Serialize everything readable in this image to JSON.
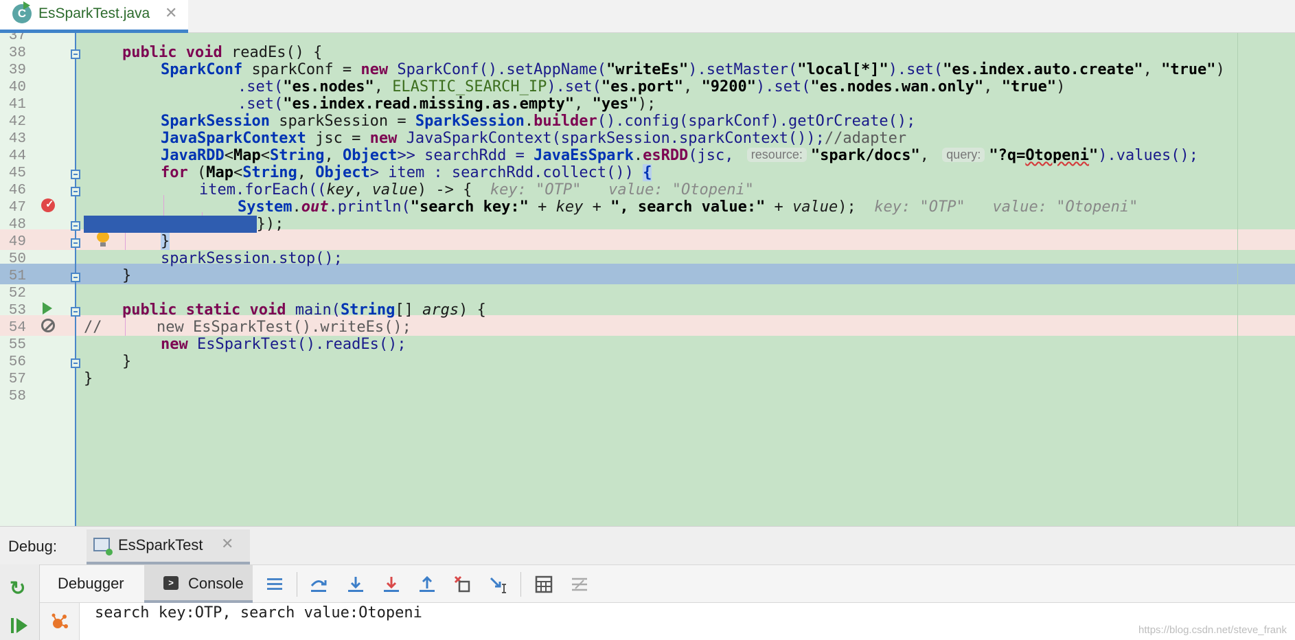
{
  "tab": {
    "icon_letter": "C",
    "title": "EsSparkTest.java",
    "close_glyph": "✕"
  },
  "editor": {
    "line_numbers": [
      "37",
      "38",
      "39",
      "40",
      "41",
      "42",
      "43",
      "44",
      "45",
      "46",
      "47",
      "48",
      "49",
      "50",
      "51",
      "52",
      "53",
      "54",
      "55",
      "56",
      "57",
      "58"
    ],
    "code": {
      "l38": [
        "public",
        "void",
        "readEs() {"
      ],
      "l39": [
        "SparkConf",
        " sparkConf = ",
        "new",
        "SparkConf",
        "().setAppName(",
        "\"writeEs\"",
        ").setMaster(",
        "\"local[*]\"",
        ").set(",
        "\"es.index.auto.create\"",
        ", ",
        "\"true\"",
        ")"
      ],
      "l40": [
        ".set(",
        "\"es.nodes\"",
        ", ",
        "ELASTIC_SEARCH_IP",
        ").set(",
        "\"es.port\"",
        ", ",
        "\"9200\"",
        ").set(",
        "\"es.nodes.wan.only\"",
        ", ",
        "\"true\"",
        ")"
      ],
      "l41": [
        ".set(",
        "\"es.index.read.missing.as.empty\"",
        ", ",
        "\"yes\"",
        ");"
      ],
      "l42": [
        "SparkSession",
        " sparkSession = ",
        "SparkSession",
        ".",
        "builder",
        "().config(sparkConf).getOrCreate();"
      ],
      "l43": [
        "JavaSparkContext",
        " jsc = ",
        "new",
        "JavaSparkContext",
        "(sparkSession.sparkContext());",
        "//adapter"
      ],
      "l44": [
        "JavaRDD",
        "<",
        "Map",
        "<",
        "String",
        ", ",
        "Object",
        ">> searchRdd = ",
        "JavaEsSpark",
        ".",
        "esRDD",
        "(jsc, ",
        "resource:",
        "\"spark/docs\"",
        ", ",
        "query:",
        "\"?q=",
        "Otopeni",
        "\"",
        ").values();"
      ],
      "l45": [
        "for",
        " (",
        "Map",
        "<",
        "String",
        ", ",
        "Object",
        "> item : searchRdd.collect()) ",
        "{"
      ],
      "l46": [
        "item.forEach((",
        "key",
        ", ",
        "value",
        ") -> {",
        "key: \"OTP\"   value: \"Otopeni\""
      ],
      "l47": [
        "System",
        ".",
        "out",
        ".println(",
        "\"search key:\"",
        " + ",
        "key",
        " + ",
        "\", search value:\"",
        " + ",
        "value",
        ");",
        "key: \"OTP\"   value: \"Otopeni\""
      ],
      "l48": [
        "});"
      ],
      "l49": [
        "}"
      ],
      "l50": [
        "sparkSession.stop();"
      ],
      "l51": [
        "}"
      ],
      "l53": [
        "public",
        "static",
        "void",
        "main(",
        "String",
        "[] ",
        "args",
        ") {"
      ],
      "l54": [
        "//",
        "new EsSparkTest().writeEs();"
      ],
      "l55": [
        "new",
        " EsSparkTest().readEs();"
      ],
      "l56": [
        "}"
      ],
      "l57": [
        "}"
      ]
    }
  },
  "debug": {
    "label": "Debug:",
    "run_tab": "EsSparkTest",
    "close_glyph": "✕",
    "tabs": [
      "Debugger",
      "Console"
    ],
    "toolbar_icons": [
      "rerun-icon",
      "resume-icon",
      "frames-menu-icon",
      "step-over-icon",
      "step-into-icon",
      "force-step-into-icon",
      "step-out-icon",
      "drop-frame-icon",
      "run-to-cursor-icon",
      "evaluate-expression-icon",
      "trace-icon"
    ]
  },
  "console": {
    "output": "search key:OTP, search value:Otopeni"
  },
  "watermark": "https://blog.csdn.net/steve_frank"
}
